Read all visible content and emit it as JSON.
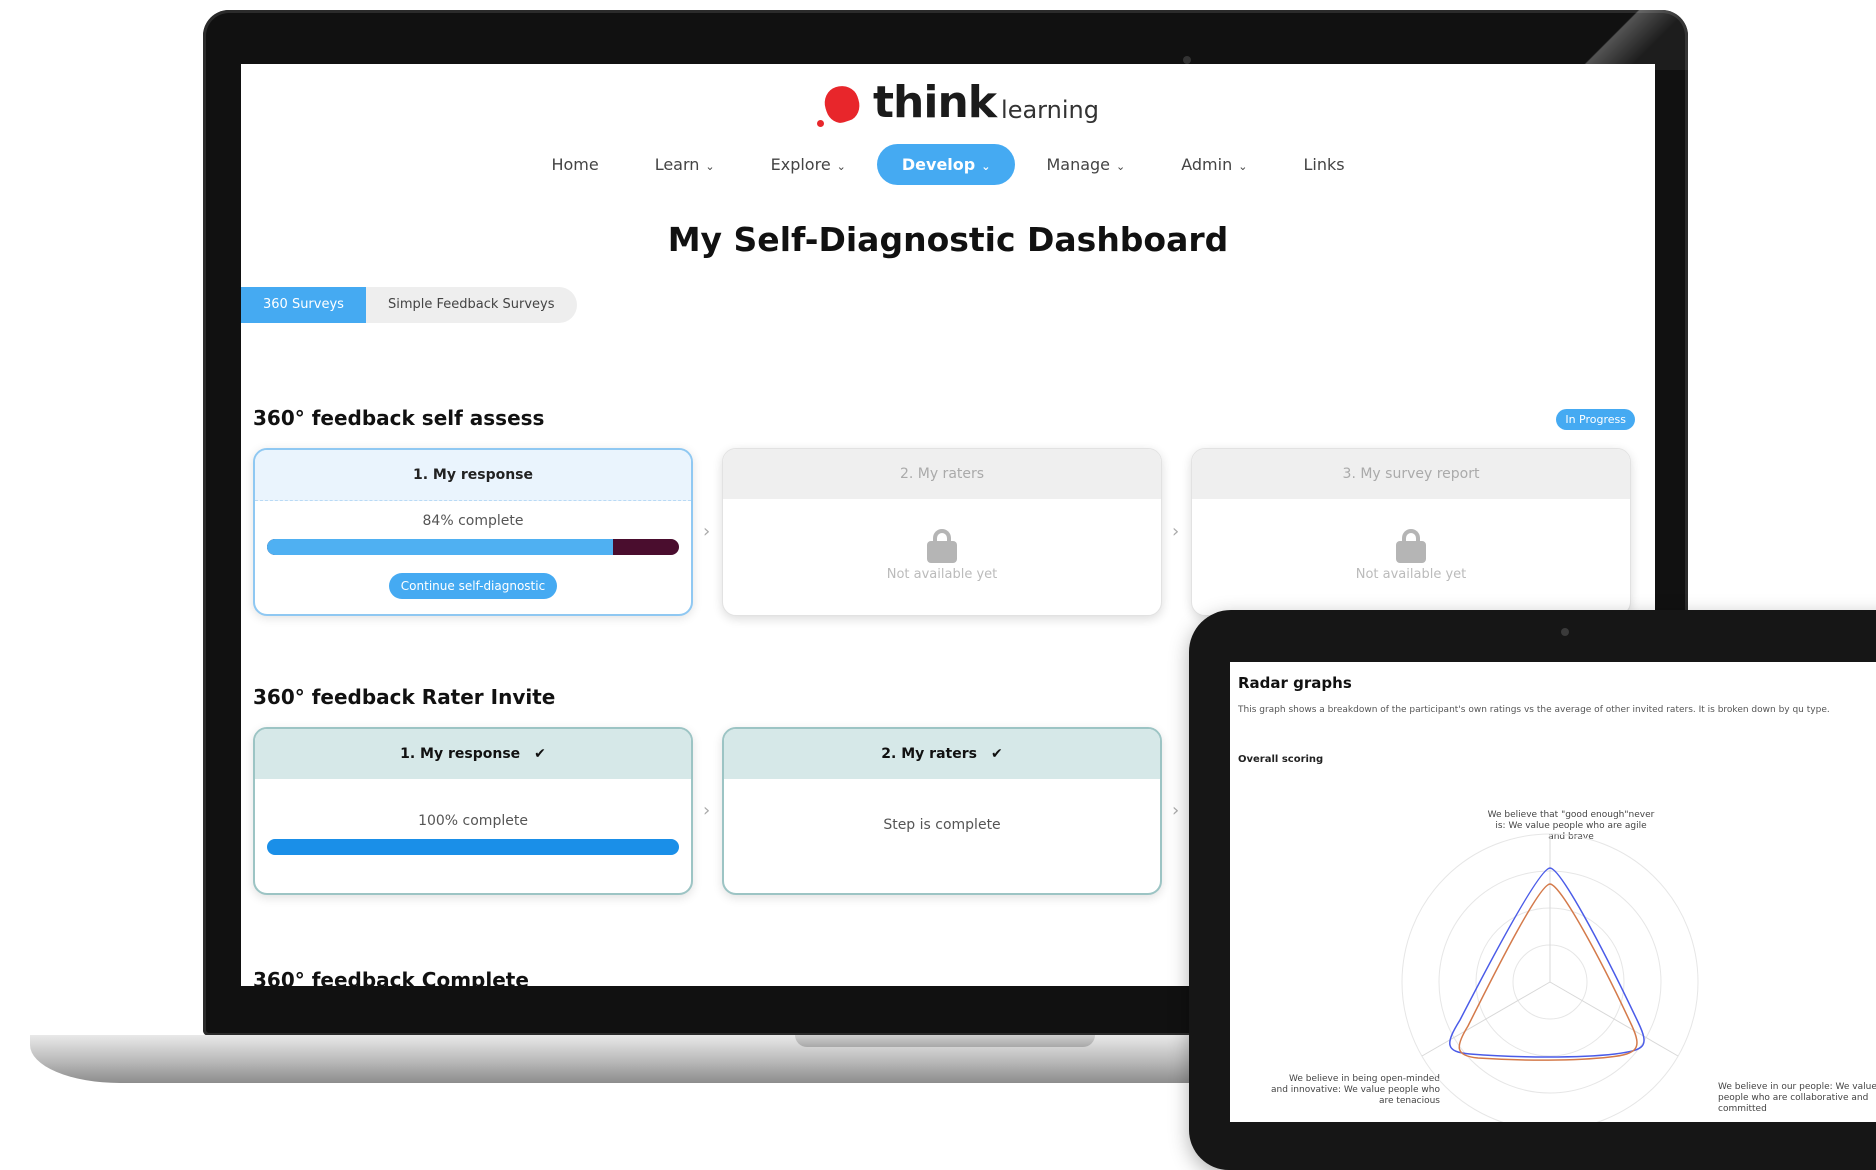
{
  "brand": {
    "name_bold": "think",
    "name_light": "learning",
    "logo_color": "#e8262b",
    "accent_color": "#45aaf2"
  },
  "nav": {
    "items": [
      {
        "label": "Home",
        "dropdown": false
      },
      {
        "label": "Learn",
        "dropdown": true
      },
      {
        "label": "Explore",
        "dropdown": true
      },
      {
        "label": "Develop",
        "dropdown": true,
        "active": true
      },
      {
        "label": "Manage",
        "dropdown": true
      },
      {
        "label": "Admin",
        "dropdown": true
      },
      {
        "label": "Links",
        "dropdown": false
      }
    ]
  },
  "page": {
    "title": "My Self-Diagnostic Dashboard"
  },
  "tabs": [
    {
      "label": "360 Surveys",
      "active": true
    },
    {
      "label": "Simple Feedback Surveys",
      "active": false
    }
  ],
  "sections": {
    "self_assess": {
      "title": "360° feedback self assess",
      "status": "In Progress",
      "steps": [
        {
          "label": "1. My response",
          "progress_text": "84% complete",
          "progress": 84,
          "button": "Continue self-diagnostic"
        },
        {
          "label": "2. My raters",
          "message": "Not available yet"
        },
        {
          "label": "3. My survey report",
          "message": "Not available yet"
        }
      ]
    },
    "rater_invite": {
      "title": "360° feedback Rater Invite",
      "steps": [
        {
          "label": "1. My response",
          "progress_text": "100% complete",
          "progress": 100
        },
        {
          "label": "2. My raters",
          "message": "Step is complete"
        }
      ]
    },
    "complete": {
      "title": "360° feedback Complete"
    }
  },
  "icons": {
    "chevron": "chevron-down-icon",
    "check": "checkmark-icon",
    "lock": "lock-icon",
    "step_arrow": "chevron-right-icon"
  },
  "glyphs": {
    "chevron_down": "⌄",
    "check": "✔",
    "arrow": "›"
  },
  "tablet": {
    "title": "Radar graphs",
    "description": "This graph shows a breakdown of the participant's own ratings vs the average of other invited raters. It is broken down by qu type.",
    "subtitle": "Overall scoring",
    "radar": {
      "axes": [
        "We believe that \"good enough\"never is: We value people who are agile and brave",
        "We believe in our people: We value people who are collaborative and committed",
        "We believe in being open-minded and innovative: We value people who are tenacious"
      ],
      "series_colors": [
        "#4a5be8",
        "#d47a4a"
      ]
    }
  }
}
